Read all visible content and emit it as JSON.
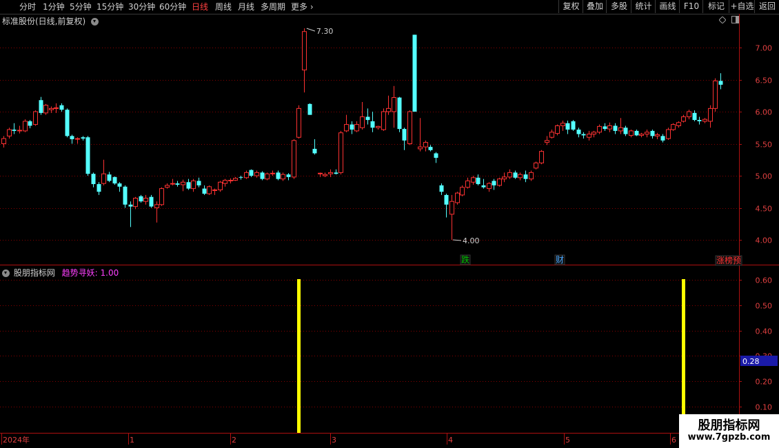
{
  "toolbar": {
    "periods": [
      "分时",
      "1分钟",
      "5分钟",
      "15分钟",
      "30分钟",
      "60分钟",
      "日线",
      "周线",
      "月线",
      "多周期",
      "更多"
    ],
    "active_period": "日线",
    "right_buttons": [
      "复权",
      "叠加",
      "多股",
      "统计",
      "画线",
      "F10",
      "标记",
      "+自选",
      "返回"
    ]
  },
  "main_panel": {
    "title": "标准股份(日线,前复权)",
    "high_marker": "7.30",
    "low_marker": "4.00",
    "events": [
      {
        "label": "跌",
        "color": "#00c000"
      },
      {
        "label": "财",
        "color": "#4aa8ff"
      },
      {
        "label": "涨榜预",
        "color": "#ff3030"
      }
    ]
  },
  "indicator_panel": {
    "name": "股朋指标网",
    "line_label": "趋势寻妖: 1.00",
    "current_value": "0.28"
  },
  "x_axis": {
    "labels": [
      "2024年",
      "1",
      "2",
      "3",
      "4",
      "5",
      "6"
    ]
  },
  "watermark": {
    "line1": "股朋指标网",
    "line2": "www.7gpzb.com"
  },
  "colors": {
    "up": "#ff3232",
    "down": "#54ffff",
    "grid": "#8b0000",
    "signal": "#ffff00"
  },
  "chart_data": [
    {
      "type": "candlestick",
      "y_ticks": [
        "4.00",
        "4.50",
        "5.00",
        "5.50",
        "6.00",
        "6.50",
        "7.00"
      ],
      "ylim": [
        3.85,
        7.35
      ],
      "candles": [
        {
          "o": 5.5,
          "h": 5.62,
          "l": 5.44,
          "c": 5.58
        },
        {
          "o": 5.62,
          "h": 5.75,
          "l": 5.58,
          "c": 5.72
        },
        {
          "o": 5.72,
          "h": 5.82,
          "l": 5.65,
          "c": 5.7
        },
        {
          "o": 5.7,
          "h": 5.78,
          "l": 5.66,
          "c": 5.71
        },
        {
          "o": 5.7,
          "h": 5.88,
          "l": 5.68,
          "c": 5.85
        },
        {
          "o": 5.85,
          "h": 5.87,
          "l": 5.74,
          "c": 5.78
        },
        {
          "o": 5.8,
          "h": 6.02,
          "l": 5.78,
          "c": 6.0
        },
        {
          "o": 6.18,
          "h": 6.23,
          "l": 5.95,
          "c": 5.98
        },
        {
          "o": 5.98,
          "h": 6.12,
          "l": 5.95,
          "c": 6.1
        },
        {
          "o": 6.03,
          "h": 6.08,
          "l": 5.98,
          "c": 6.05
        },
        {
          "o": 6.05,
          "h": 6.13,
          "l": 5.98,
          "c": 6.06
        },
        {
          "o": 6.1,
          "h": 6.13,
          "l": 6.0,
          "c": 6.03
        },
        {
          "o": 6.03,
          "h": 6.05,
          "l": 5.6,
          "c": 5.62
        },
        {
          "o": 5.62,
          "h": 5.64,
          "l": 5.5,
          "c": 5.57
        },
        {
          "o": 5.57,
          "h": 5.6,
          "l": 5.5,
          "c": 5.58
        },
        {
          "o": 5.6,
          "h": 5.62,
          "l": 5.55,
          "c": 5.58
        },
        {
          "o": 5.6,
          "h": 5.62,
          "l": 5.0,
          "c": 5.03
        },
        {
          "o": 5.03,
          "h": 5.05,
          "l": 4.82,
          "c": 4.87
        },
        {
          "o": 4.87,
          "h": 4.9,
          "l": 4.7,
          "c": 4.75
        },
        {
          "o": 4.88,
          "h": 5.25,
          "l": 4.85,
          "c": 5.03
        },
        {
          "o": 5.02,
          "h": 5.06,
          "l": 4.9,
          "c": 4.92
        },
        {
          "o": 4.98,
          "h": 4.99,
          "l": 4.86,
          "c": 4.88
        },
        {
          "o": 4.88,
          "h": 4.9,
          "l": 4.75,
          "c": 4.83
        },
        {
          "o": 4.83,
          "h": 4.85,
          "l": 4.5,
          "c": 4.55
        },
        {
          "o": 4.55,
          "h": 4.6,
          "l": 4.2,
          "c": 4.52
        },
        {
          "o": 4.52,
          "h": 4.67,
          "l": 4.48,
          "c": 4.65
        },
        {
          "o": 4.68,
          "h": 4.7,
          "l": 4.58,
          "c": 4.6
        },
        {
          "o": 4.6,
          "h": 4.7,
          "l": 4.55,
          "c": 4.65
        },
        {
          "o": 4.67,
          "h": 4.7,
          "l": 4.5,
          "c": 4.52
        },
        {
          "o": 4.5,
          "h": 4.6,
          "l": 4.27,
          "c": 4.55
        },
        {
          "o": 4.55,
          "h": 4.82,
          "l": 4.53,
          "c": 4.8
        },
        {
          "o": 4.82,
          "h": 4.88,
          "l": 4.8,
          "c": 4.85
        },
        {
          "o": 4.88,
          "h": 4.95,
          "l": 4.85,
          "c": 4.88
        },
        {
          "o": 4.88,
          "h": 4.92,
          "l": 4.83,
          "c": 4.86
        },
        {
          "o": 4.86,
          "h": 4.94,
          "l": 4.76,
          "c": 4.9
        },
        {
          "o": 4.9,
          "h": 4.95,
          "l": 4.78,
          "c": 4.8
        },
        {
          "o": 4.8,
          "h": 4.95,
          "l": 4.75,
          "c": 4.92
        },
        {
          "o": 4.92,
          "h": 4.97,
          "l": 4.82,
          "c": 4.85
        },
        {
          "o": 4.8,
          "h": 4.85,
          "l": 4.7,
          "c": 4.72
        },
        {
          "o": 4.72,
          "h": 4.85,
          "l": 4.7,
          "c": 4.83
        },
        {
          "o": 4.77,
          "h": 4.8,
          "l": 4.7,
          "c": 4.78
        },
        {
          "o": 4.78,
          "h": 4.92,
          "l": 4.75,
          "c": 4.9
        },
        {
          "o": 4.88,
          "h": 4.95,
          "l": 4.83,
          "c": 4.93
        },
        {
          "o": 4.92,
          "h": 4.96,
          "l": 4.88,
          "c": 4.93
        },
        {
          "o": 4.93,
          "h": 4.98,
          "l": 4.92,
          "c": 4.96
        },
        {
          "o": 4.98,
          "h": 5.0,
          "l": 4.94,
          "c": 4.97
        },
        {
          "o": 4.97,
          "h": 5.08,
          "l": 4.95,
          "c": 5.05
        },
        {
          "o": 5.09,
          "h": 5.1,
          "l": 4.98,
          "c": 5.0
        },
        {
          "o": 5.0,
          "h": 5.08,
          "l": 4.97,
          "c": 5.05
        },
        {
          "o": 5.05,
          "h": 5.07,
          "l": 4.93,
          "c": 4.95
        },
        {
          "o": 4.95,
          "h": 5.05,
          "l": 4.93,
          "c": 5.03
        },
        {
          "o": 5.03,
          "h": 5.08,
          "l": 5.0,
          "c": 5.04
        },
        {
          "o": 5.05,
          "h": 5.08,
          "l": 4.93,
          "c": 4.95
        },
        {
          "o": 4.95,
          "h": 5.05,
          "l": 4.92,
          "c": 5.02
        },
        {
          "o": 5.02,
          "h": 5.04,
          "l": 4.93,
          "c": 4.98
        },
        {
          "o": 4.98,
          "h": 5.57,
          "l": 4.95,
          "c": 5.55
        },
        {
          "o": 5.6,
          "h": 6.1,
          "l": 5.58,
          "c": 6.05
        },
        {
          "o": 6.65,
          "h": 7.3,
          "l": 6.3,
          "c": 7.25
        },
        {
          "o": 6.12,
          "h": 6.13,
          "l": 5.95,
          "c": 5.95
        },
        {
          "o": 5.42,
          "h": 5.57,
          "l": 5.33,
          "c": 5.35
        },
        {
          "o": 5.03,
          "h": 5.05,
          "l": 4.98,
          "c": 5.04
        },
        {
          "o": 5.0,
          "h": 5.05,
          "l": 4.98,
          "c": 5.02
        },
        {
          "o": 5.03,
          "h": 5.1,
          "l": 4.98,
          "c": 5.05
        },
        {
          "o": 5.05,
          "h": 5.1,
          "l": 5.02,
          "c": 5.03
        },
        {
          "o": 5.05,
          "h": 5.7,
          "l": 5.02,
          "c": 5.67
        },
        {
          "o": 5.7,
          "h": 5.95,
          "l": 5.68,
          "c": 5.8
        },
        {
          "o": 5.8,
          "h": 5.85,
          "l": 5.65,
          "c": 5.72
        },
        {
          "o": 5.7,
          "h": 5.85,
          "l": 5.68,
          "c": 5.8
        },
        {
          "o": 5.75,
          "h": 6.15,
          "l": 5.72,
          "c": 5.92
        },
        {
          "o": 5.92,
          "h": 6.05,
          "l": 5.8,
          "c": 5.87
        },
        {
          "o": 5.85,
          "h": 6.0,
          "l": 5.68,
          "c": 5.75
        },
        {
          "o": 5.75,
          "h": 5.78,
          "l": 5.72,
          "c": 5.77
        },
        {
          "o": 5.72,
          "h": 6.05,
          "l": 5.7,
          "c": 6.0
        },
        {
          "o": 6.0,
          "h": 6.25,
          "l": 5.95,
          "c": 6.05
        },
        {
          "o": 6.0,
          "h": 6.4,
          "l": 5.75,
          "c": 6.22
        },
        {
          "o": 6.22,
          "h": 6.23,
          "l": 5.68,
          "c": 5.73
        },
        {
          "o": 5.73,
          "h": 5.75,
          "l": 5.4,
          "c": 5.55
        },
        {
          "o": 5.5,
          "h": 6.02,
          "l": 5.48,
          "c": 6.0
        },
        {
          "o": 7.2,
          "h": 7.2,
          "l": 6.0,
          "c": 6.0
        },
        {
          "o": 5.42,
          "h": 5.9,
          "l": 5.38,
          "c": 5.45
        },
        {
          "o": 5.45,
          "h": 5.55,
          "l": 5.38,
          "c": 5.52
        },
        {
          "o": 5.45,
          "h": 5.48,
          "l": 5.38,
          "c": 5.4
        },
        {
          "o": 5.35,
          "h": 5.37,
          "l": 5.2,
          "c": 5.28
        },
        {
          "o": 4.85,
          "h": 4.88,
          "l": 4.7,
          "c": 4.75
        },
        {
          "o": 4.7,
          "h": 4.72,
          "l": 4.35,
          "c": 4.55
        },
        {
          "o": 4.4,
          "h": 4.7,
          "l": 4.0,
          "c": 4.6
        },
        {
          "o": 4.58,
          "h": 4.75,
          "l": 4.55,
          "c": 4.73
        },
        {
          "o": 4.7,
          "h": 4.85,
          "l": 4.68,
          "c": 4.82
        },
        {
          "o": 4.82,
          "h": 4.97,
          "l": 4.8,
          "c": 4.92
        },
        {
          "o": 4.9,
          "h": 5.0,
          "l": 4.86,
          "c": 4.97
        },
        {
          "o": 4.97,
          "h": 5.02,
          "l": 4.85,
          "c": 4.87
        },
        {
          "o": 4.85,
          "h": 4.95,
          "l": 4.8,
          "c": 4.82
        },
        {
          "o": 4.8,
          "h": 4.9,
          "l": 4.75,
          "c": 4.88
        },
        {
          "o": 4.92,
          "h": 4.95,
          "l": 4.78,
          "c": 4.85
        },
        {
          "o": 4.85,
          "h": 4.97,
          "l": 4.83,
          "c": 4.95
        },
        {
          "o": 4.95,
          "h": 5.05,
          "l": 4.9,
          "c": 4.98
        },
        {
          "o": 4.98,
          "h": 5.1,
          "l": 4.95,
          "c": 5.05
        },
        {
          "o": 5.05,
          "h": 5.08,
          "l": 4.95,
          "c": 4.97
        },
        {
          "o": 4.97,
          "h": 5.05,
          "l": 4.93,
          "c": 5.02
        },
        {
          "o": 5.02,
          "h": 5.08,
          "l": 4.9,
          "c": 4.95
        },
        {
          "o": 4.95,
          "h": 5.08,
          "l": 4.92,
          "c": 5.05
        },
        {
          "o": 5.12,
          "h": 5.22,
          "l": 5.1,
          "c": 5.2
        },
        {
          "o": 5.2,
          "h": 5.4,
          "l": 5.18,
          "c": 5.38
        },
        {
          "o": 5.52,
          "h": 5.62,
          "l": 5.48,
          "c": 5.55
        },
        {
          "o": 5.6,
          "h": 5.72,
          "l": 5.58,
          "c": 5.68
        },
        {
          "o": 5.66,
          "h": 5.8,
          "l": 5.63,
          "c": 5.78
        },
        {
          "o": 5.78,
          "h": 5.86,
          "l": 5.7,
          "c": 5.82
        },
        {
          "o": 5.82,
          "h": 5.86,
          "l": 5.65,
          "c": 5.72
        },
        {
          "o": 5.85,
          "h": 5.87,
          "l": 5.7,
          "c": 5.72
        },
        {
          "o": 5.72,
          "h": 5.75,
          "l": 5.6,
          "c": 5.65
        },
        {
          "o": 5.65,
          "h": 5.68,
          "l": 5.58,
          "c": 5.63
        },
        {
          "o": 5.6,
          "h": 5.7,
          "l": 5.55,
          "c": 5.65
        },
        {
          "o": 5.65,
          "h": 5.7,
          "l": 5.6,
          "c": 5.68
        },
        {
          "o": 5.68,
          "h": 5.8,
          "l": 5.65,
          "c": 5.77
        },
        {
          "o": 5.77,
          "h": 5.82,
          "l": 5.7,
          "c": 5.73
        },
        {
          "o": 5.73,
          "h": 5.83,
          "l": 5.68,
          "c": 5.78
        },
        {
          "o": 5.78,
          "h": 5.82,
          "l": 5.65,
          "c": 5.7
        },
        {
          "o": 5.7,
          "h": 5.9,
          "l": 5.65,
          "c": 5.75
        },
        {
          "o": 5.75,
          "h": 5.78,
          "l": 5.62,
          "c": 5.65
        },
        {
          "o": 5.63,
          "h": 5.72,
          "l": 5.6,
          "c": 5.7
        },
        {
          "o": 5.7,
          "h": 5.72,
          "l": 5.62,
          "c": 5.63
        },
        {
          "o": 5.63,
          "h": 5.67,
          "l": 5.6,
          "c": 5.65
        },
        {
          "o": 5.65,
          "h": 5.72,
          "l": 5.6,
          "c": 5.68
        },
        {
          "o": 5.7,
          "h": 5.72,
          "l": 5.58,
          "c": 5.62
        },
        {
          "o": 5.62,
          "h": 5.67,
          "l": 5.57,
          "c": 5.64
        },
        {
          "o": 5.62,
          "h": 5.65,
          "l": 5.52,
          "c": 5.55
        },
        {
          "o": 5.58,
          "h": 5.75,
          "l": 5.56,
          "c": 5.72
        },
        {
          "o": 5.72,
          "h": 5.82,
          "l": 5.7,
          "c": 5.8
        },
        {
          "o": 5.78,
          "h": 5.85,
          "l": 5.75,
          "c": 5.83
        },
        {
          "o": 5.85,
          "h": 5.95,
          "l": 5.83,
          "c": 5.92
        },
        {
          "o": 5.92,
          "h": 6.03,
          "l": 5.88,
          "c": 6.0
        },
        {
          "o": 5.98,
          "h": 6.02,
          "l": 5.85,
          "c": 5.87
        },
        {
          "o": 5.87,
          "h": 5.92,
          "l": 5.8,
          "c": 5.85
        },
        {
          "o": 5.85,
          "h": 5.9,
          "l": 5.82,
          "c": 5.88
        },
        {
          "o": 5.85,
          "h": 6.1,
          "l": 5.75,
          "c": 6.05
        },
        {
          "o": 6.05,
          "h": 6.52,
          "l": 6.0,
          "c": 6.48
        },
        {
          "o": 6.48,
          "h": 6.6,
          "l": 6.35,
          "c": 6.42
        }
      ]
    },
    {
      "type": "bar",
      "y_ticks": [
        "0.10",
        "0.20",
        "0.30",
        "0.40",
        "0.50",
        "0.60"
      ],
      "ylim": [
        0.0,
        0.65
      ],
      "signals": [
        {
          "candle_index": 56,
          "value": 1.0
        },
        {
          "candle_index": 129,
          "value": 1.0
        }
      ]
    }
  ]
}
